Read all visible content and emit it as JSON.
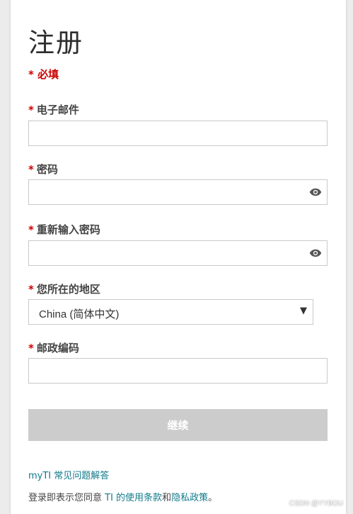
{
  "form": {
    "title": "注册",
    "required_star": "*",
    "required_note": "必填"
  },
  "fields": {
    "email": {
      "label": "电子邮件",
      "value": ""
    },
    "password": {
      "label": "密码",
      "value": ""
    },
    "confirm_password": {
      "label": "重新输入密码",
      "value": ""
    },
    "region": {
      "label": "您所在的地区",
      "selected": "China (简体中文)"
    },
    "postal_code": {
      "label": "邮政编码",
      "value": ""
    }
  },
  "icons": {
    "password_toggle": "eye-icon",
    "select_caret": "caret-down-icon"
  },
  "buttons": {
    "continue": "继续"
  },
  "footer": {
    "faq_link": "myTI 常见问题解答",
    "terms_prefix": "登录即表示您同意 ",
    "terms_link": "TI 的使用条款",
    "terms_and": "和",
    "privacy_link": "隐私政策",
    "terms_suffix": "。"
  },
  "watermark": "CSDN @YYBOU",
  "colors": {
    "required": "#cc0000",
    "link": "#117a8b",
    "button_disabled": "#cccccc"
  }
}
